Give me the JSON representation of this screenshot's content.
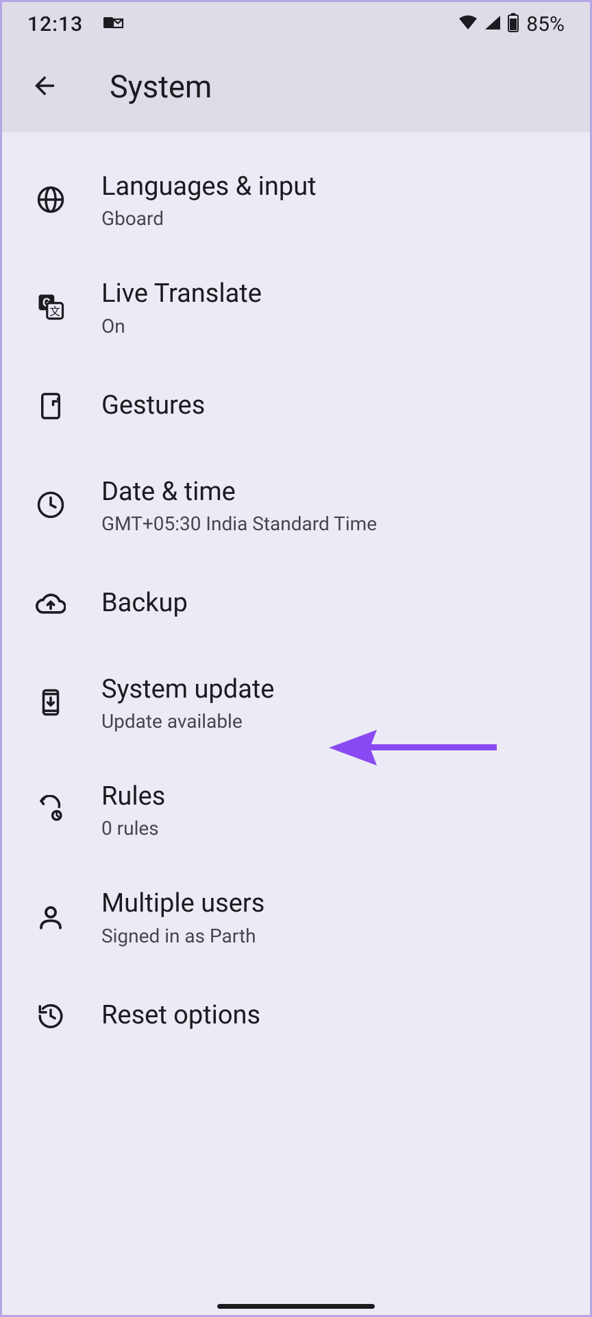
{
  "status_bar": {
    "time": "12:13",
    "battery": "85%"
  },
  "header": {
    "title": "System"
  },
  "items": [
    {
      "title": "Languages & input",
      "subtitle": "Gboard"
    },
    {
      "title": "Live Translate",
      "subtitle": "On"
    },
    {
      "title": "Gestures",
      "subtitle": ""
    },
    {
      "title": "Date & time",
      "subtitle": "GMT+05:30 India Standard Time"
    },
    {
      "title": "Backup",
      "subtitle": ""
    },
    {
      "title": "System update",
      "subtitle": "Update available"
    },
    {
      "title": "Rules",
      "subtitle": "0 rules"
    },
    {
      "title": "Multiple users",
      "subtitle": "Signed in as Parth"
    },
    {
      "title": "Reset options",
      "subtitle": ""
    }
  ]
}
